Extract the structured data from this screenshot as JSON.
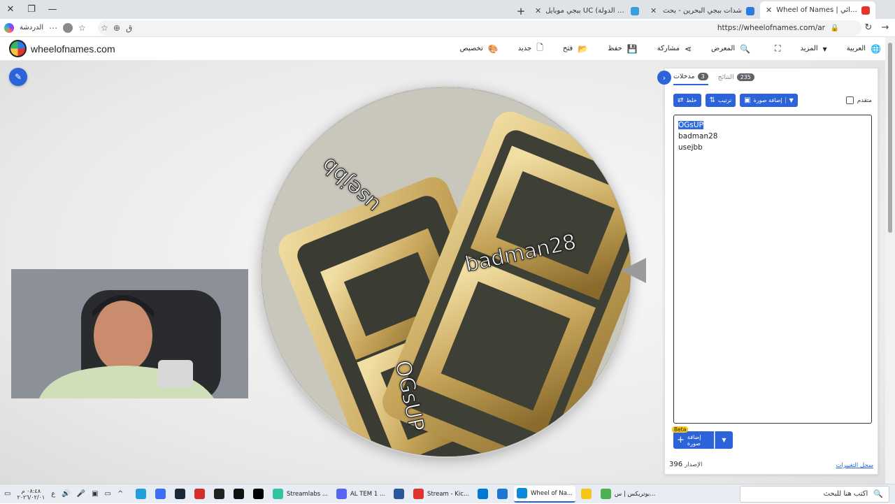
{
  "window": {
    "close": "✕",
    "restore": "❐",
    "minimize": "—"
  },
  "tabs": [
    {
      "title": "Wheel of Names | الاسم العشوائي",
      "active": true,
      "color": "#e3342f"
    },
    {
      "title": "شدات ببجي البحرين - بحث",
      "active": false,
      "color": "#2d7ae0"
    },
    {
      "title": "ببجي موبايل UC (اسم الدولة) | خصم...",
      "active": false,
      "color": "#38a0e0"
    }
  ],
  "address_bar": {
    "url": "https://wheelofnames.com/ar",
    "chat_label": "الدردشة"
  },
  "site": {
    "brand": "wheelofnames.com",
    "menu": [
      {
        "label": "العربية",
        "icon": "globe-icon",
        "glyph": "🌐"
      },
      {
        "label": "المزيد",
        "icon": "caret-down-icon",
        "glyph": "▾"
      },
      {
        "label": "",
        "icon": "fullscreen-icon",
        "glyph": "⛶"
      },
      {
        "label": "المعرض",
        "icon": "search-icon",
        "glyph": "🔍"
      },
      {
        "label": "مشاركة",
        "icon": "share-icon",
        "glyph": "⋖"
      },
      {
        "label": "حفظ",
        "icon": "save-icon",
        "glyph": "💾"
      },
      {
        "label": "فتح",
        "icon": "folder-icon",
        "glyph": "📂"
      },
      {
        "label": "جديد",
        "icon": "file-icon",
        "glyph": "🗋"
      },
      {
        "label": "تخصيص",
        "icon": "palette-icon",
        "glyph": "🎨"
      }
    ]
  },
  "wheel": {
    "labels": [
      "OGsUP",
      "badman28",
      "usejbb"
    ]
  },
  "panel": {
    "tabs": [
      {
        "label": "مدخلات",
        "count": "3"
      },
      {
        "label": "النتائج",
        "count": "235"
      }
    ],
    "buttons": {
      "shuffle": "خلط",
      "sort": "ترتيب",
      "add_image": "إضافة صورة",
      "advanced": "متقدم"
    },
    "entries": [
      "OGsUP",
      "badman28",
      "usejbb"
    ],
    "add_image_bottom": "إضافة صورة",
    "beta": "Beta",
    "version_label": "الإصدار",
    "version": "396",
    "changelog": "سجل التغييرات"
  },
  "taskbar": {
    "time": "٠٨:٤٨ م",
    "date": "٢٠٢٦/٠٢/٠١",
    "lang": "ع",
    "search_placeholder": "اكتب هنا للبحث",
    "apps": [
      {
        "label": "",
        "color": "#229ed9"
      },
      {
        "label": "",
        "color": "#3b6ef5"
      },
      {
        "label": "",
        "color": "#1b2838"
      },
      {
        "label": "",
        "color": "#d32f2f"
      },
      {
        "label": "",
        "color": "#222"
      },
      {
        "label": "",
        "color": "#111"
      },
      {
        "label": "",
        "color": "#000"
      },
      {
        "label": "Streamlabs ...",
        "color": "#31c3a2"
      },
      {
        "label": "AL TEM 1 ...",
        "color": "#5865f2"
      },
      {
        "label": "",
        "color": "#2b579a"
      },
      {
        "label": "Stream - Kic...",
        "color": "#e0332f"
      },
      {
        "label": "",
        "color": "#0078d4"
      },
      {
        "label": "",
        "color": "#1c76d2"
      },
      {
        "label": "Wheel of Na...",
        "color": "#0c8ad8",
        "active": true
      },
      {
        "label": "",
        "color": "#f5c518"
      },
      {
        "label": "بوتريكس | س...",
        "color": "#4caf50"
      }
    ]
  }
}
